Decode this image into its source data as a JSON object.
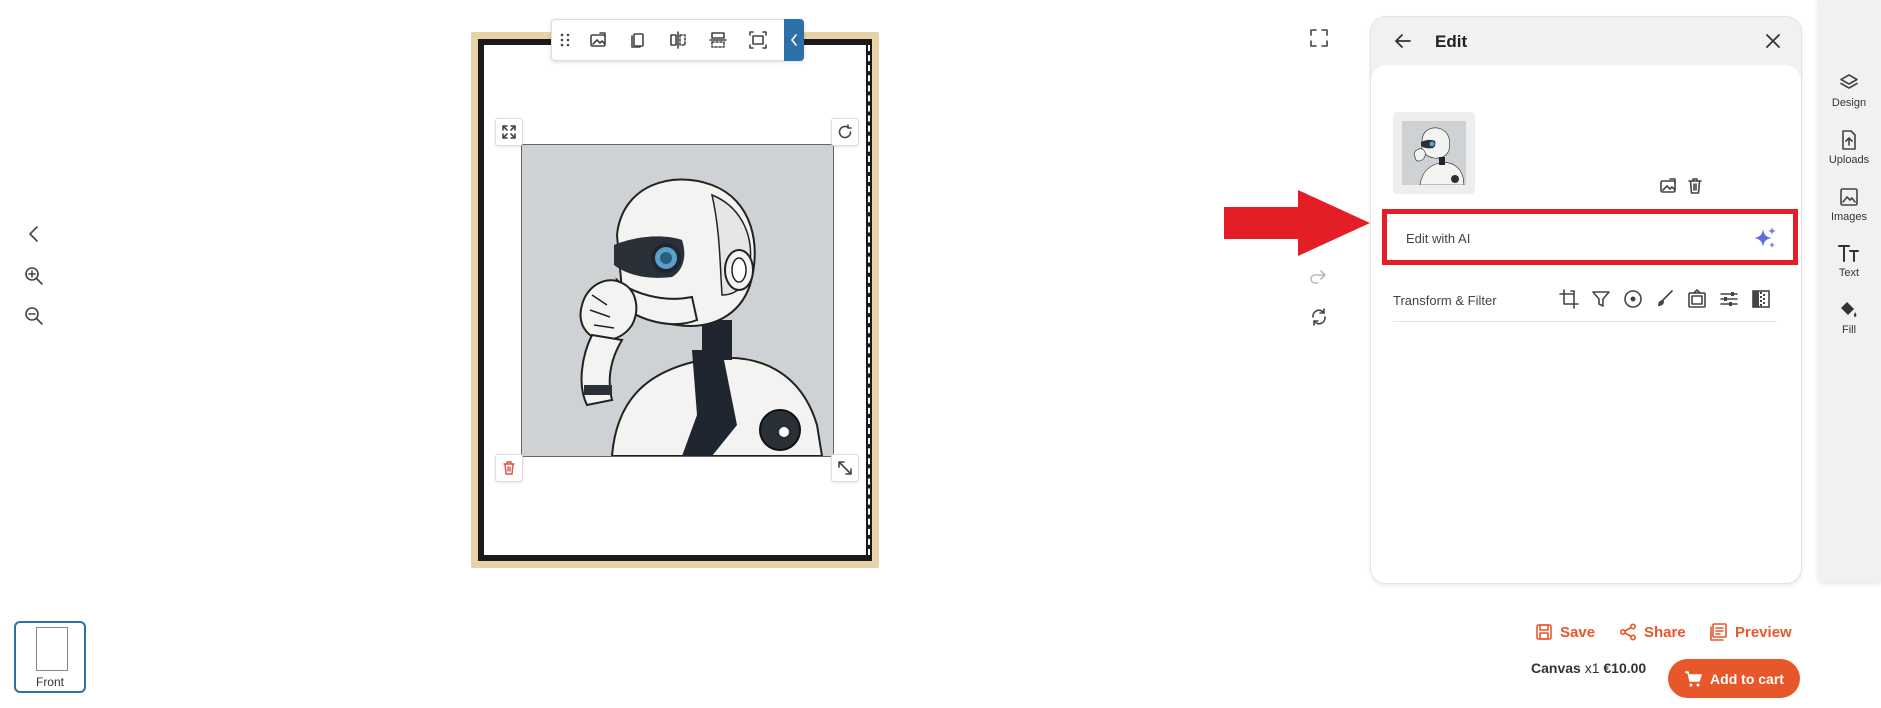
{
  "canvas_tools": {
    "back_icon": "chevron-left-icon",
    "zoom_in_icon": "zoom-in-icon",
    "zoom_out_icon": "zoom-out-icon"
  },
  "floating_toolbar": {
    "icons": [
      "drag-handle-icon",
      "replace-image-icon",
      "duplicate-icon",
      "flip-horizontal-icon",
      "flip-vertical-icon",
      "fit-to-frame-icon",
      "collapse-chevron-icon"
    ]
  },
  "image_handles": {
    "top_left": "expand-icon",
    "top_right": "rotate-icon",
    "bottom_left": "trash-icon",
    "bottom_right": "resize-icon"
  },
  "middle_tools": {
    "fullscreen_icon": "fullscreen-icon",
    "redo_icon": "redo-icon",
    "reset_icon": "refresh-icon"
  },
  "edit_panel": {
    "title": "Edit",
    "edit_ai_label": "Edit with AI",
    "transform_label": "Transform & Filter",
    "transform_icons": [
      "crop-icon",
      "filter-icon",
      "focus-icon",
      "brush-icon",
      "frame-icon",
      "adjust-icon",
      "gradient-icon"
    ]
  },
  "right_rail": {
    "items": [
      {
        "label": "Design",
        "icon": "layers-icon"
      },
      {
        "label": "Uploads",
        "icon": "upload-icon"
      },
      {
        "label": "Images",
        "icon": "image-icon"
      },
      {
        "label": "Text",
        "icon": "text-icon"
      },
      {
        "label": "Fill",
        "icon": "paint-bucket-icon"
      }
    ]
  },
  "actions": {
    "save": "Save",
    "share": "Share",
    "preview": "Preview"
  },
  "price": {
    "product": "Canvas",
    "quantity": "x1",
    "amount": "€10.00"
  },
  "cart": {
    "label": "Add to cart"
  },
  "pages": {
    "front_label": "Front"
  },
  "colors": {
    "accent": "#e8572a",
    "highlight": "#e41e26",
    "toolbar_blue": "#2d6fa8",
    "ai_sparkle": "#5b6ee1"
  }
}
